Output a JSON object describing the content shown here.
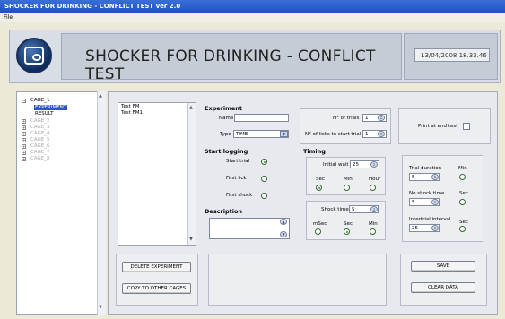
{
  "window": {
    "title": "SHOCKER FOR DRINKING - CONFLICT TEST ver 2.0"
  },
  "menu": {
    "file": "File"
  },
  "header": {
    "title": "SHOCKER FOR DRINKING - CONFLICT TEST",
    "datetime": "13/04/2008 18.33.46"
  },
  "tree": {
    "root": "CAGE_1",
    "children": [
      "EXPERIMENT",
      "RESULT"
    ],
    "cages": [
      "CAGE_2",
      "CAGE_3",
      "CAGE_4",
      "CAGE_5",
      "CAGE_6",
      "CAGE_7",
      "CAGE_8"
    ]
  },
  "list": {
    "items": [
      "Test FM",
      "Test FM1"
    ]
  },
  "experiment": {
    "title": "Experiment",
    "name_label": "Name",
    "name_value": "",
    "type_label": "Type",
    "type_value": "TIME",
    "trials_label": "N° of trials",
    "trials_value": "1",
    "licks_label": "N° of licks to start trial",
    "licks_value": "1",
    "print_label": "Print at end test"
  },
  "start_logging": {
    "title": "Start logging",
    "options": [
      "Start trial",
      "First lick",
      "First shock"
    ],
    "selected": 0
  },
  "description": {
    "title": "Description",
    "value": ""
  },
  "timing": {
    "title": "Timing",
    "initial_wait_label": "Initial wait",
    "initial_wait_value": "25",
    "initial_units": [
      "Sec",
      "Min",
      "Hour"
    ],
    "initial_selected": 0,
    "shock_time_label": "Shock time",
    "shock_time_value": "5",
    "shock_units": [
      "mSec",
      "Sec",
      "Min"
    ],
    "shock_selected": 1,
    "trial_duration_label": "Trial duration",
    "trial_duration_value": "5",
    "trial_duration_unit": "Min",
    "no_shock_label": "No shock time",
    "no_shock_value": "5",
    "no_shock_unit": "Sec",
    "intertrial_label": "Intertrial interval",
    "intertrial_value": "25",
    "intertrial_unit": "Sec"
  },
  "buttons": {
    "delete": "DELETE EXPERIMENT",
    "copy": "COPY TO OTHER CAGES",
    "save": "SAVE",
    "clear": "CLEAR DATA"
  },
  "colors": {
    "titlebar": "#2a5fcc",
    "accent_green": "#3a8f2f",
    "selected": "#2f53c8"
  }
}
